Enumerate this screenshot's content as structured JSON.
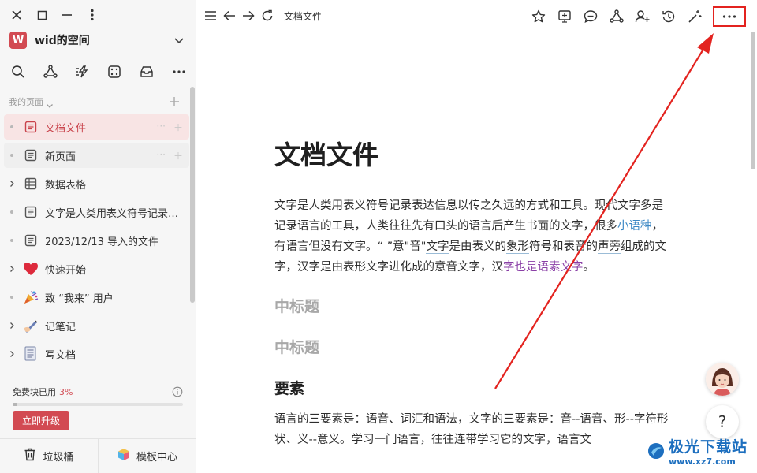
{
  "window": {
    "controls": [
      "close-icon",
      "maximize-icon",
      "minimize-icon",
      "kebab-icon"
    ]
  },
  "space": {
    "avatar_letter": "W",
    "name": "wid的空间",
    "accent": "#d24a52"
  },
  "sidebar": {
    "toolbar": [
      "search-icon",
      "graph-icon",
      "lightning-list-icon",
      "dice-icon",
      "inbox-icon",
      "more-icon"
    ],
    "section_label": "我的页面",
    "items": [
      {
        "label": "文档文件",
        "lead": "dot",
        "icon": "doc-icon",
        "state": "active"
      },
      {
        "label": "新页面",
        "lead": "dot",
        "icon": "doc-icon",
        "state": "hover"
      },
      {
        "label": "数据表格",
        "lead": "chevron",
        "icon": "table-icon",
        "state": ""
      },
      {
        "label": "文字是人类用表义符号记录…",
        "lead": "dot",
        "icon": "doc-icon",
        "state": ""
      },
      {
        "label": "2023/12/13 导入的文件",
        "lead": "dot",
        "icon": "doc-icon",
        "state": ""
      },
      {
        "label": "快速开始",
        "lead": "chevron",
        "icon": "heart-emoji",
        "state": ""
      },
      {
        "label": "致 “我来” 用户",
        "lead": "dot",
        "icon": "party-emoji",
        "state": ""
      },
      {
        "label": "记笔记",
        "lead": "chevron",
        "icon": "writing-hand-emoji",
        "state": ""
      },
      {
        "label": "写文档",
        "lead": "chevron",
        "icon": "document-emoji",
        "state": ""
      }
    ],
    "quota": {
      "label": "免费块已用",
      "percent_text": "3%",
      "fraction": 0.03
    },
    "upgrade_label": "立即升级",
    "footer": {
      "trash_label": "垃圾桶",
      "templates_label": "模板中心"
    }
  },
  "topbar": {
    "breadcrumb": "文档文件",
    "right_icons": [
      "star-icon",
      "present-icon",
      "comment-icon",
      "graph-icon",
      "add-user-icon",
      "history-icon",
      "magic-wand-icon",
      "more-icon"
    ],
    "highlight_color": "#e3231f"
  },
  "doc": {
    "title": "文档文件",
    "para1_a": "文字是人类用表义符号记录表达信息以传之久远的方式和工具。现代文字多是记录语言的工具，人类往往先有口头的语言后产生书面的文字，很多",
    "para1_link": "小语种",
    "para1_b": "，有语言但没有文字。“ ”意\"音\"",
    "para1_c": "文字",
    "para1_d": "是由表义的",
    "para1_e": "象形",
    "para1_f": "符号和表音的",
    "para1_g": "声旁",
    "para1_h": "组成的文字，",
    "para1_i": "汉字",
    "para1_j": "是由表形文字进化成的意音文字，汉",
    "para1_k": "字也是",
    "para1_l": "语素文字",
    "para1_m": "。",
    "h2_1": "中标题",
    "h2_2": "中标题",
    "h3": "要素",
    "para2_a": "语言的三要素是：",
    "para2_b": "语音",
    "para2_c": "、词汇和语法，文字的三要素是：音--语音、形--字符形状、义--意义。学习一门语言，往往连带学习它的文字，语言文"
  },
  "floating": {
    "help_label": "?"
  },
  "watermark": {
    "text": "极光下载站",
    "url": "www.xz7.com"
  }
}
